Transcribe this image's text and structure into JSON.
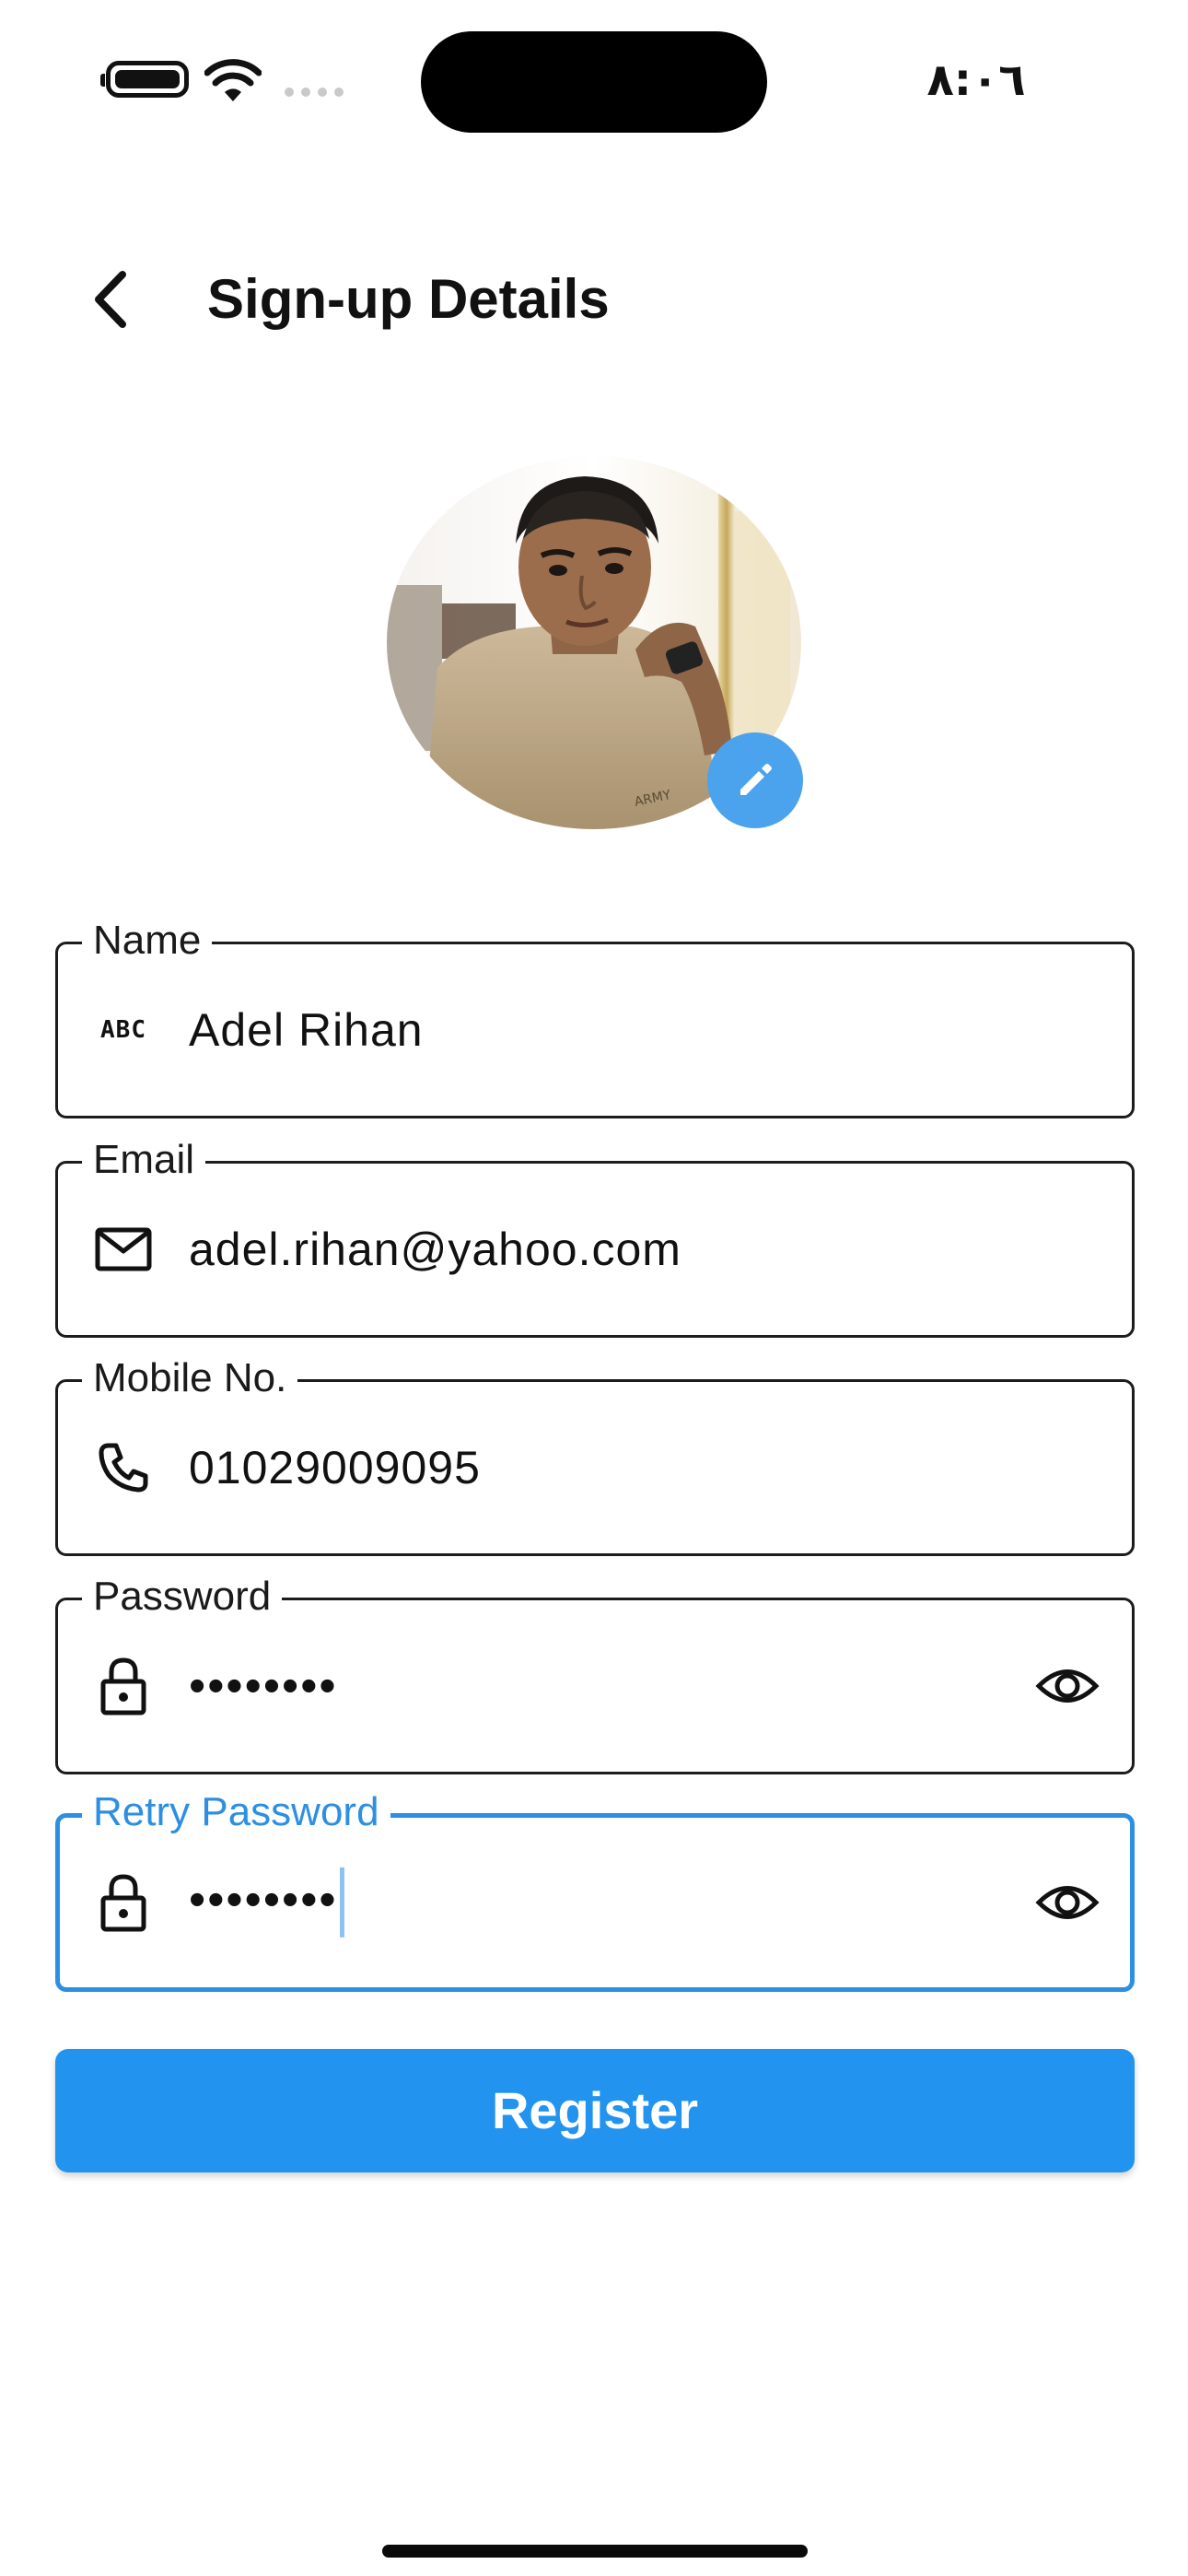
{
  "status_bar": {
    "time": "٨:٠٦",
    "icons": [
      "battery-icon",
      "wifi-icon",
      "signal-icon"
    ]
  },
  "header": {
    "title": "Sign-up Details",
    "back_icon": "chevron-left-icon"
  },
  "avatar": {
    "edit_icon": "pencil-icon",
    "edit_color": "#4aa3ec"
  },
  "form": {
    "name": {
      "label": "Name",
      "value": "Adel Rihan",
      "icon": "abc-icon",
      "icon_text": "ABC"
    },
    "email": {
      "label": "Email",
      "value": "adel.rihan@yahoo.com",
      "icon": "mail-icon"
    },
    "mobile": {
      "label": "Mobile No.",
      "value": "01029009095",
      "icon": "phone-icon"
    },
    "password": {
      "label": "Password",
      "value": "••••••••",
      "icon": "lock-icon",
      "toggle_icon": "eye-icon"
    },
    "retry_password": {
      "label": "Retry Password",
      "value": "••••••••",
      "icon": "lock-icon",
      "toggle_icon": "eye-icon",
      "focused": true
    }
  },
  "register": {
    "label": "Register"
  },
  "colors": {
    "accent": "#2293ee",
    "focus_border": "#2d8fe3",
    "text": "#111111",
    "border": "#1c1c1c"
  }
}
